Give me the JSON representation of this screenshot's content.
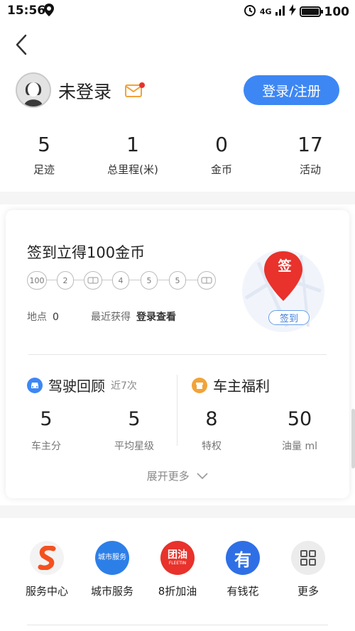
{
  "status": {
    "time": "15:56",
    "battery": "100",
    "network": "4G"
  },
  "profile": {
    "name": "未登录",
    "login_label": "登录/注册"
  },
  "stats": [
    {
      "value": "5",
      "label": "足迹"
    },
    {
      "value": "1",
      "label": "总里程(米)"
    },
    {
      "value": "0",
      "label": "金币"
    },
    {
      "value": "17",
      "label": "活动"
    }
  ],
  "signin": {
    "title": "签到立得100金币",
    "days": [
      "100",
      "2",
      "",
      "4",
      "5",
      "5",
      ""
    ],
    "location_label": "地点",
    "location_value": "0",
    "recent_label": "最近获得",
    "recent_value": "登录查看",
    "marker_text": "签",
    "button": "签到"
  },
  "driving": {
    "title": "驾驶回顾",
    "subtitle": "近7次",
    "metrics": [
      {
        "value": "5",
        "label": "车主分"
      },
      {
        "value": "5",
        "label": "平均星级"
      }
    ]
  },
  "owner": {
    "title": "车主福利",
    "metrics": [
      {
        "value": "8",
        "label": "特权"
      },
      {
        "value": "50",
        "label": "油量 ml"
      }
    ]
  },
  "expand_label": "展开更多",
  "services": [
    {
      "label": "服务中心",
      "icon": "service-center-icon"
    },
    {
      "label": "城市服务",
      "icon": "city-service-icon",
      "icon_text": "城市服务"
    },
    {
      "label": "8折加油",
      "icon": "fuel-discount-icon",
      "icon_text": "团油",
      "icon_sub": "FLEETIN"
    },
    {
      "label": "有钱花",
      "icon": "credit-icon",
      "icon_text": "有"
    },
    {
      "label": "更多",
      "icon": "more-grid-icon"
    }
  ],
  "colors": {
    "accent": "#3d87f4",
    "red": "#e8322b",
    "orange": "#f2a33a"
  }
}
